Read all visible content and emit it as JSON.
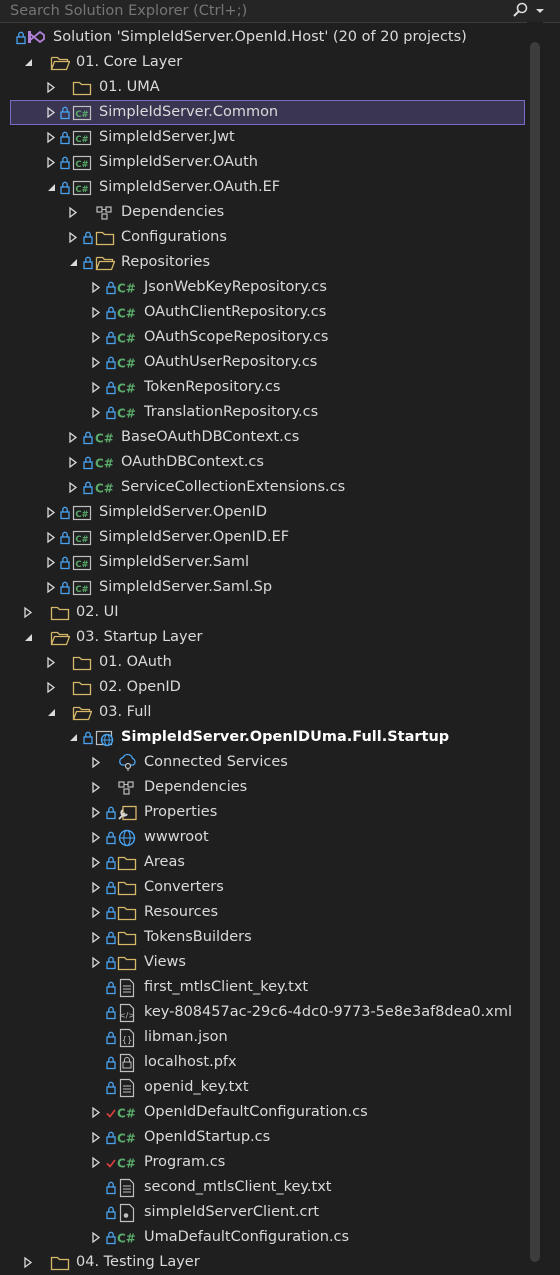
{
  "search": {
    "placeholder": "Search Solution Explorer (Ctrl+;)"
  },
  "colors": {
    "background": "#1f1f1f",
    "selection": "#3a3550",
    "selection_border": "#7b68c8",
    "csharp": "#5aaa6a",
    "folder": "#d7b86a",
    "edited_check": "#e04040"
  },
  "tree": [
    {
      "label": "Solution 'SimpleIdServer.OpenId.Host' (20 of 20 projects)",
      "level": 0,
      "expander": "none",
      "lock": true,
      "icon": "solution"
    },
    {
      "label": "01. Core Layer",
      "level": 1,
      "expander": "open",
      "lock": false,
      "icon": "folder-open"
    },
    {
      "label": "01. UMA",
      "level": 2,
      "expander": "closed",
      "lock": false,
      "icon": "folder"
    },
    {
      "label": "SimpleIdServer.Common",
      "level": 2,
      "expander": "closed",
      "lock": true,
      "icon": "csproj",
      "selected": true
    },
    {
      "label": "SimpleIdServer.Jwt",
      "level": 2,
      "expander": "closed",
      "lock": true,
      "icon": "csproj"
    },
    {
      "label": "SimpleIdServer.OAuth",
      "level": 2,
      "expander": "closed",
      "lock": true,
      "icon": "csproj"
    },
    {
      "label": "SimpleIdServer.OAuth.EF",
      "level": 2,
      "expander": "open",
      "lock": true,
      "icon": "csproj"
    },
    {
      "label": "Dependencies",
      "level": 3,
      "expander": "closed",
      "lock": false,
      "icon": "dependencies"
    },
    {
      "label": "Configurations",
      "level": 3,
      "expander": "closed",
      "lock": true,
      "icon": "folder"
    },
    {
      "label": "Repositories",
      "level": 3,
      "expander": "open",
      "lock": true,
      "icon": "folder-open"
    },
    {
      "label": "JsonWebKeyRepository.cs",
      "level": 4,
      "expander": "closed",
      "lock": true,
      "icon": "csharp"
    },
    {
      "label": "OAuthClientRepository.cs",
      "level": 4,
      "expander": "closed",
      "lock": true,
      "icon": "csharp"
    },
    {
      "label": "OAuthScopeRepository.cs",
      "level": 4,
      "expander": "closed",
      "lock": true,
      "icon": "csharp"
    },
    {
      "label": "OAuthUserRepository.cs",
      "level": 4,
      "expander": "closed",
      "lock": true,
      "icon": "csharp"
    },
    {
      "label": "TokenRepository.cs",
      "level": 4,
      "expander": "closed",
      "lock": true,
      "icon": "csharp"
    },
    {
      "label": "TranslationRepository.cs",
      "level": 4,
      "expander": "closed",
      "lock": true,
      "icon": "csharp"
    },
    {
      "label": "BaseOAuthDBContext.cs",
      "level": 3,
      "expander": "closed",
      "lock": true,
      "icon": "csharp"
    },
    {
      "label": "OAuthDBContext.cs",
      "level": 3,
      "expander": "closed",
      "lock": true,
      "icon": "csharp"
    },
    {
      "label": "ServiceCollectionExtensions.cs",
      "level": 3,
      "expander": "closed",
      "lock": true,
      "icon": "csharp"
    },
    {
      "label": "SimpleIdServer.OpenID",
      "level": 2,
      "expander": "closed",
      "lock": true,
      "icon": "csproj"
    },
    {
      "label": "SimpleIdServer.OpenID.EF",
      "level": 2,
      "expander": "closed",
      "lock": true,
      "icon": "csproj"
    },
    {
      "label": "SimpleIdServer.Saml",
      "level": 2,
      "expander": "closed",
      "lock": true,
      "icon": "csproj"
    },
    {
      "label": "SimpleIdServer.Saml.Sp",
      "level": 2,
      "expander": "closed",
      "lock": true,
      "icon": "csproj"
    },
    {
      "label": "02. UI",
      "level": 1,
      "expander": "closed",
      "lock": false,
      "icon": "folder"
    },
    {
      "label": "03. Startup Layer",
      "level": 1,
      "expander": "open",
      "lock": false,
      "icon": "folder-open"
    },
    {
      "label": "01. OAuth",
      "level": 2,
      "expander": "closed",
      "lock": false,
      "icon": "folder"
    },
    {
      "label": "02. OpenID",
      "level": 2,
      "expander": "closed",
      "lock": false,
      "icon": "folder"
    },
    {
      "label": "03. Full",
      "level": 2,
      "expander": "open",
      "lock": false,
      "icon": "folder-open"
    },
    {
      "label": "SimpleIdServer.OpenIDUma.Full.Startup",
      "level": 3,
      "expander": "open",
      "lock": true,
      "icon": "webproj",
      "bold": true
    },
    {
      "label": "Connected Services",
      "level": 4,
      "expander": "closed",
      "lock": false,
      "icon": "connected-services"
    },
    {
      "label": "Dependencies",
      "level": 4,
      "expander": "closed",
      "lock": false,
      "icon": "dependencies"
    },
    {
      "label": "Properties",
      "level": 4,
      "expander": "closed",
      "lock": true,
      "icon": "properties"
    },
    {
      "label": "wwwroot",
      "level": 4,
      "expander": "closed",
      "lock": true,
      "icon": "globe"
    },
    {
      "label": "Areas",
      "level": 4,
      "expander": "closed",
      "lock": true,
      "icon": "folder"
    },
    {
      "label": "Converters",
      "level": 4,
      "expander": "closed",
      "lock": true,
      "icon": "folder"
    },
    {
      "label": "Resources",
      "level": 4,
      "expander": "closed",
      "lock": true,
      "icon": "folder"
    },
    {
      "label": "TokensBuilders",
      "level": 4,
      "expander": "closed",
      "lock": true,
      "icon": "folder"
    },
    {
      "label": "Views",
      "level": 4,
      "expander": "closed",
      "lock": true,
      "icon": "folder"
    },
    {
      "label": "first_mtlsClient_key.txt",
      "level": 4,
      "expander": "none",
      "lock": true,
      "icon": "text-file"
    },
    {
      "label": "key-808457ac-29c6-4dc0-9773-5e8e3af8dea0.xml",
      "level": 4,
      "expander": "none",
      "lock": true,
      "icon": "xml-file"
    },
    {
      "label": "libman.json",
      "level": 4,
      "expander": "none",
      "lock": true,
      "icon": "json-file"
    },
    {
      "label": "localhost.pfx",
      "level": 4,
      "expander": "none",
      "lock": true,
      "icon": "pfx-file"
    },
    {
      "label": "openid_key.txt",
      "level": 4,
      "expander": "none",
      "lock": true,
      "icon": "text-file"
    },
    {
      "label": "OpenIdDefaultConfiguration.cs",
      "level": 4,
      "expander": "closed",
      "lock": false,
      "check": true,
      "icon": "csharp"
    },
    {
      "label": "OpenIdStartup.cs",
      "level": 4,
      "expander": "closed",
      "lock": true,
      "icon": "csharp"
    },
    {
      "label": "Program.cs",
      "level": 4,
      "expander": "closed",
      "lock": false,
      "check": true,
      "icon": "csharp"
    },
    {
      "label": "second_mtlsClient_key.txt",
      "level": 4,
      "expander": "none",
      "lock": true,
      "icon": "text-file"
    },
    {
      "label": "simpleIdServerClient.crt",
      "level": 4,
      "expander": "none",
      "lock": true,
      "icon": "cert-file"
    },
    {
      "label": "UmaDefaultConfiguration.cs",
      "level": 4,
      "expander": "closed",
      "lock": true,
      "icon": "csharp"
    },
    {
      "label": "04. Testing Layer",
      "level": 1,
      "expander": "closed",
      "lock": false,
      "icon": "folder"
    }
  ]
}
